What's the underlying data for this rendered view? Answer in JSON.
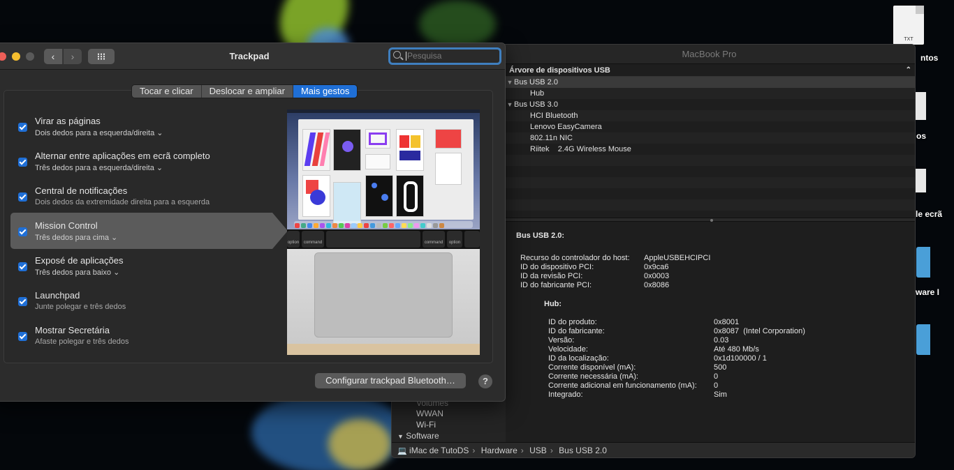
{
  "desktop": {
    "doc_icon_label": "TXT",
    "labels": [
      "ntos",
      "os",
      "le ecrã",
      "ware I"
    ]
  },
  "trackpad": {
    "window_title": "Trackpad",
    "search_placeholder": "Pesquisa",
    "tabs": [
      {
        "label": "Tocar e clicar",
        "active": false
      },
      {
        "label": "Deslocar e ampliar",
        "active": false
      },
      {
        "label": "Mais gestos",
        "active": true
      }
    ],
    "options": [
      {
        "title": "Virar as páginas",
        "subtitle": "Dois dedos para a esquerda/direita",
        "dropdown": true,
        "checked": true
      },
      {
        "title": "Alternar entre aplicações em ecrã completo",
        "subtitle": "Três dedos para a esquerda/direita",
        "dropdown": true,
        "checked": true
      },
      {
        "title": "Central de notificações",
        "subtitle": "Dois dedos da extremidade direita para a esquerda",
        "dropdown": false,
        "checked": true
      },
      {
        "title": "Mission Control",
        "subtitle": "Três dedos para cima",
        "dropdown": true,
        "checked": true,
        "selected": true
      },
      {
        "title": "Exposé de aplicações",
        "subtitle": "Três dedos para baixo",
        "dropdown": true,
        "checked": true
      },
      {
        "title": "Launchpad",
        "subtitle": "Junte polegar e três dedos",
        "dropdown": false,
        "checked": true
      },
      {
        "title": "Mostrar Secretária",
        "subtitle": "Afaste polegar e três dedos",
        "dropdown": false,
        "checked": true
      }
    ],
    "bluetooth_button": "Configurar trackpad Bluetooth…",
    "help_button": "?",
    "preview_keys": [
      "option",
      "command",
      "command",
      "option"
    ]
  },
  "sysinfo": {
    "window_title": "MacBook Pro",
    "sidebar": [
      {
        "label": "Volumes",
        "section": false
      },
      {
        "label": "WWAN",
        "section": false
      },
      {
        "label": "Wi-Fi",
        "section": false
      },
      {
        "label": "Software",
        "section": true
      }
    ],
    "tree_header": "Árvore de dispositivos USB",
    "tree": [
      {
        "label": "Bus USB 2.0",
        "level": 0,
        "expanded": true,
        "selected": true
      },
      {
        "label": "Hub",
        "level": 1
      },
      {
        "label": "Bus USB 3.0",
        "level": 0,
        "expanded": true
      },
      {
        "label": "HCI Bluetooth",
        "level": 1
      },
      {
        "label": "Lenovo EasyCamera",
        "level": 1
      },
      {
        "label": "802.11n NIC",
        "level": 1
      },
      {
        "label": "Riitek    2.4G Wireless Mouse",
        "level": 1
      }
    ],
    "detail_title": "Bus USB 2.0:",
    "detail_rows": [
      {
        "key": "Recurso do controlador do host:",
        "value": "AppleUSBEHCIPCI"
      },
      {
        "key": "ID do dispositivo PCI:",
        "value": "0x9ca6"
      },
      {
        "key": "ID da revisão PCI:",
        "value": "0x0003"
      },
      {
        "key": "ID do fabricante PCI:",
        "value": "0x8086"
      }
    ],
    "hub_title": "Hub:",
    "hub_rows": [
      {
        "key": "ID do produto:",
        "value": "0x8001"
      },
      {
        "key": "ID do fabricante:",
        "value": "0x8087  (Intel Corporation)"
      },
      {
        "key": "Versão:",
        "value": "0.03"
      },
      {
        "key": "Velocidade:",
        "value": "Até 480 Mb/s"
      },
      {
        "key": "ID da localização:",
        "value": "0x1d100000 / 1"
      },
      {
        "key": "Corrente disponível (mA):",
        "value": "500"
      },
      {
        "key": "Corrente necessária (mA):",
        "value": "0"
      },
      {
        "key": "Corrente adicional em funcionamento (mA):",
        "value": "0"
      },
      {
        "key": "Integrado:",
        "value": "Sim"
      }
    ],
    "path": [
      "iMac de TutoDS",
      "Hardware",
      "USB",
      "Bus USB 2.0"
    ]
  },
  "colors": {
    "accent": "#1f6fd6",
    "window_bg": "#2c2c2c",
    "selected_row": "#5b5b5b"
  }
}
